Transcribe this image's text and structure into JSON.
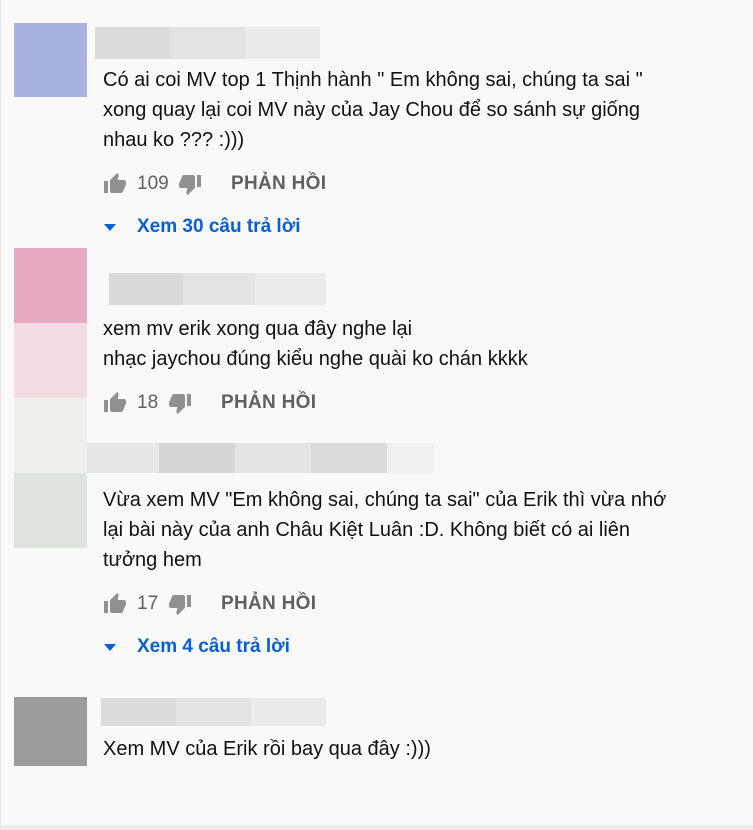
{
  "comments": [
    {
      "avatar_color": "#a9b1e0",
      "text_lines": [
        "Có ai coi MV top 1 Thịnh hành \" Em không sai, chúng ta sai \"",
        "xong quay lại coi MV này của Jay Chou để so sánh sự giống",
        "nhau ko ??? :)))"
      ],
      "likes": "109",
      "reply_label": "PHẢN HỒI",
      "view_replies": "Xem 30 câu trả lời"
    },
    {
      "avatar_colors": [
        "#e6a8c2",
        "#f3dbe4"
      ],
      "text_lines": [
        "xem mv erik xong qua đây nghe lại",
        "nhạc jaychou đúng kiểu nghe quài ko chán kkkk"
      ],
      "likes": "18",
      "reply_label": "PHẢN HỒI"
    },
    {
      "avatar_colors": [
        "#eef0ec",
        "#dde3dd"
      ],
      "text_lines": [
        "Vừa xem MV \"Em không sai, chúng ta sai\" của Erik thì vừa nhớ",
        "lại bài này của anh Châu Kiệt Luân :D. Không biết có ai liên",
        "tưởng hem"
      ],
      "likes": "17",
      "reply_label": "PHẢN HỒI",
      "view_replies": "Xem 4 câu trả lời"
    },
    {
      "avatar_color": "#9d9c9d",
      "text_lines": [
        "Xem MV của Erik rồi bay qua đây :)))"
      ]
    }
  ],
  "colors": {
    "link": "#065fd4",
    "secondary_text": "#606060",
    "background": "#f9f9f9"
  },
  "icons": [
    "thumbs-up-icon",
    "thumbs-down-icon",
    "caret-down-icon"
  ]
}
